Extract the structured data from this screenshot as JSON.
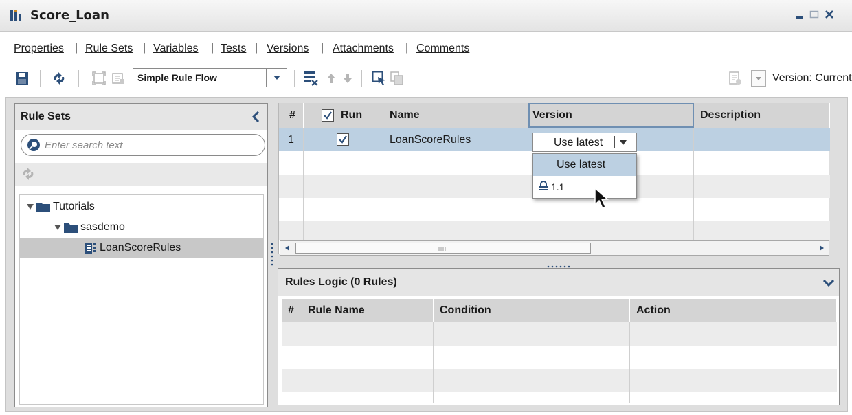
{
  "window": {
    "title": "Score_Loan"
  },
  "tabs": [
    "Properties",
    "Rule Sets",
    "Variables",
    "Tests",
    "Versions",
    "Attachments",
    "Comments"
  ],
  "toolbar": {
    "flow_type": "Simple Rule Flow",
    "version_label": "Version: Current"
  },
  "left_panel": {
    "title": "Rule Sets",
    "search_placeholder": "Enter search text",
    "tree": [
      {
        "label": "Tutorials",
        "level": 0,
        "kind": "folder",
        "expanded": true
      },
      {
        "label": "sasdemo",
        "level": 1,
        "kind": "folder",
        "expanded": true
      },
      {
        "label": "LoanScoreRules",
        "level": 2,
        "kind": "ruleset",
        "selected": true
      }
    ]
  },
  "grid": {
    "headers": {
      "index": "#",
      "run": "Run",
      "name": "Name",
      "version": "Version",
      "description": "Description"
    },
    "run_header_checked": true,
    "rows": [
      {
        "index": "1",
        "run": true,
        "name": "LoanScoreRules",
        "version": "Use latest",
        "description": ""
      }
    ]
  },
  "version_dropdown": {
    "selected": "Use latest",
    "options": [
      "Use latest",
      "1.1"
    ]
  },
  "rules_logic": {
    "title": "Rules Logic (0 Rules)",
    "headers": {
      "index": "#",
      "rule_name": "Rule Name",
      "condition": "Condition",
      "action": "Action"
    }
  },
  "colors": {
    "selection_blue": "#bcd0e2",
    "header_gray": "#d4d4d4",
    "panel_gray": "#dedede"
  }
}
